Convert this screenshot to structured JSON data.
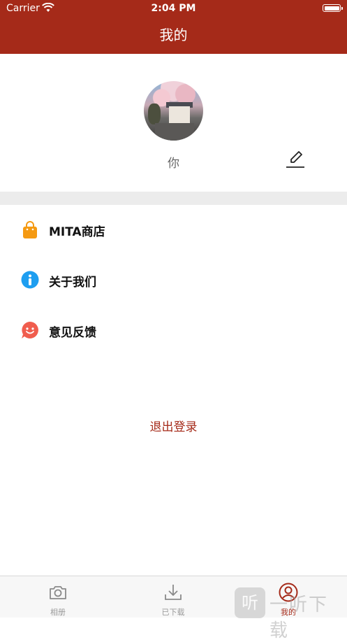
{
  "status_bar": {
    "carrier": "Carrier",
    "time": "2:04 PM"
  },
  "header": {
    "title": "我的"
  },
  "profile": {
    "name": "你"
  },
  "menu": [
    {
      "label": "MITA商店",
      "icon": "shopping-bag-icon",
      "color": "#f59a12"
    },
    {
      "label": "关于我们",
      "icon": "info-icon",
      "color": "#1e9ef0"
    },
    {
      "label": "意见反馈",
      "icon": "smile-chat-icon",
      "color": "#f05d4e"
    }
  ],
  "logout_label": "退出登录",
  "tabs": [
    {
      "label": "相册",
      "icon": "camera-icon",
      "active": false
    },
    {
      "label": "已下载",
      "icon": "download-icon",
      "active": false
    },
    {
      "label": "我的",
      "icon": "profile-icon",
      "active": true
    }
  ],
  "watermark": {
    "logo_text": "听",
    "text": "一听下载"
  },
  "colors": {
    "brand": "#a52a19",
    "separator": "#ececec",
    "tab_inactive": "#9a9a9a"
  }
}
